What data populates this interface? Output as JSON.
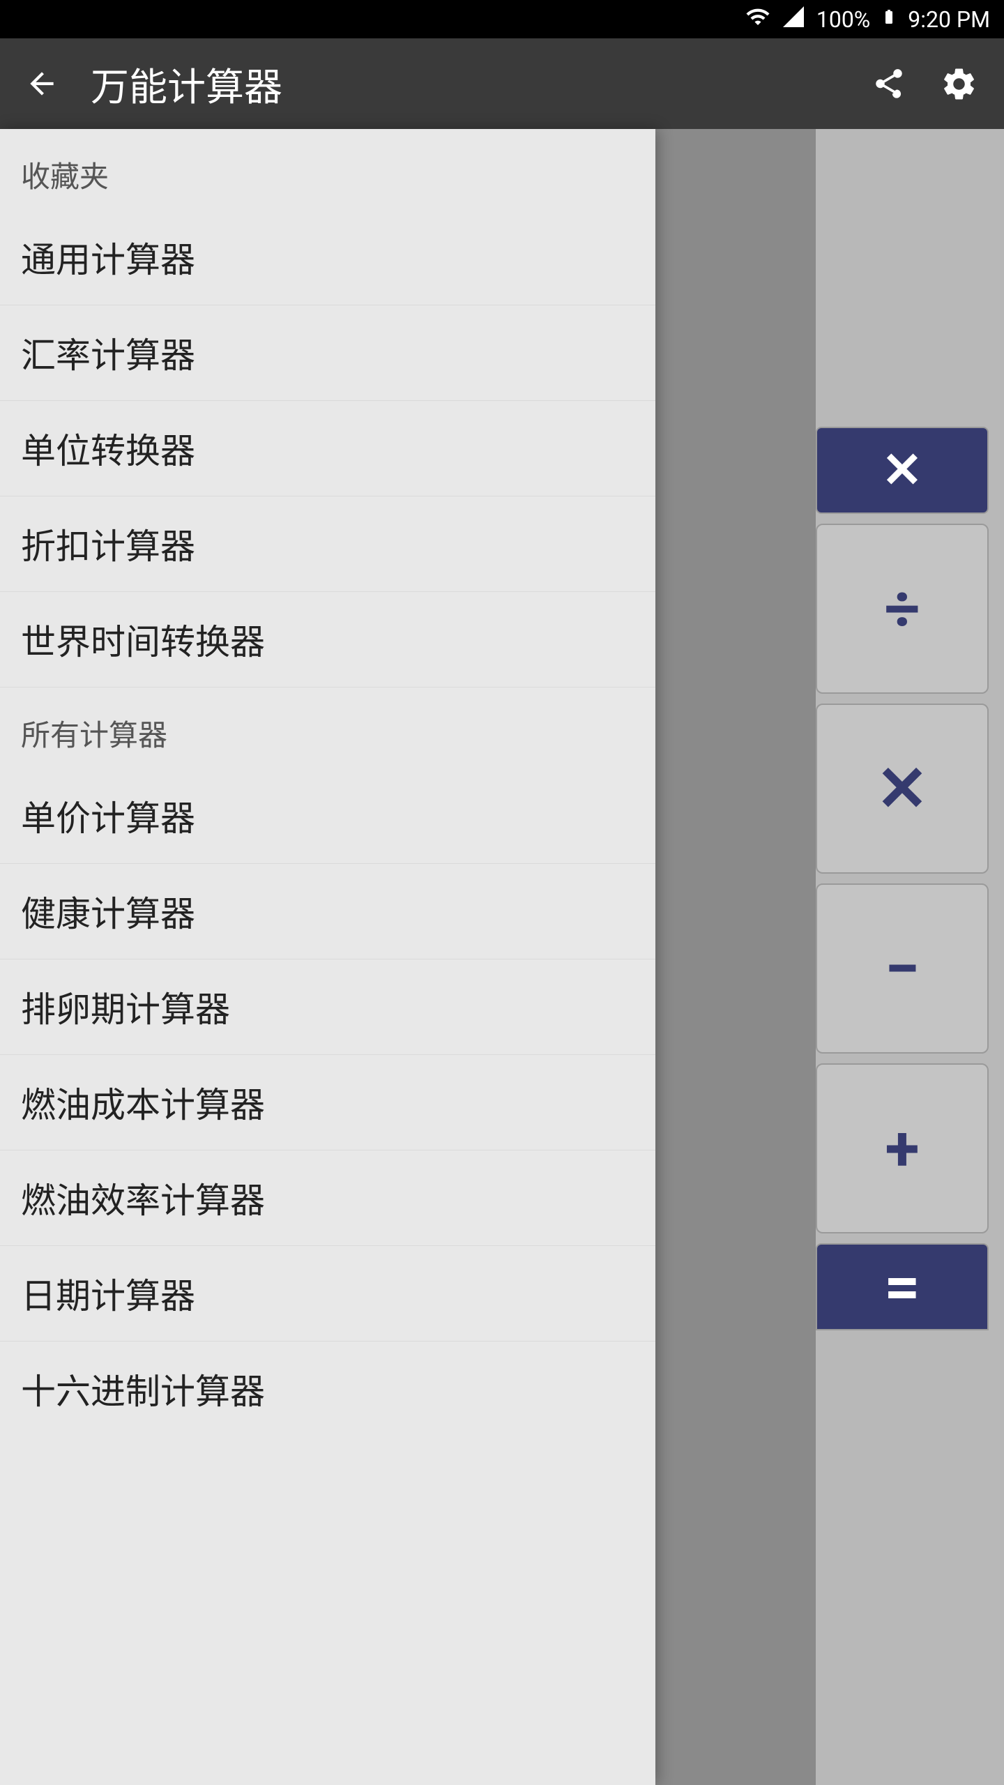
{
  "statusBar": {
    "battery": "100%",
    "time": "9:20 PM"
  },
  "appBar": {
    "title": "万能计算器"
  },
  "drawer": {
    "sections": [
      {
        "header": "收藏夹",
        "items": [
          "通用计算器",
          "汇率计算器",
          "单位转换器",
          "折扣计算器",
          "世界时间转换器"
        ]
      },
      {
        "header": "所有计算器",
        "items": [
          "单价计算器",
          "健康计算器",
          "排卵期计算器",
          "燃油成本计算器",
          "燃油效率计算器",
          "日期计算器",
          "十六进制计算器"
        ]
      }
    ]
  },
  "calculator": {
    "buttons": [
      "✕",
      "÷",
      "✕",
      "−",
      "+",
      "="
    ]
  }
}
